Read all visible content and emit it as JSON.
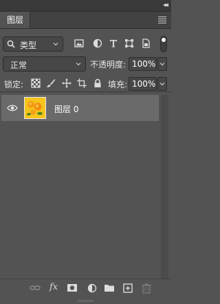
{
  "window": {
    "collapse_icon": "double-chevron-right-icon"
  },
  "tabs": [
    {
      "label": "图层",
      "active": true
    }
  ],
  "panel_menu_icon": "hamburger-menu-icon",
  "filter": {
    "selected": "类型",
    "icons": [
      "pixel-filter-icon",
      "adjustment-filter-icon",
      "type-filter-icon",
      "shape-filter-icon",
      "smart-object-filter-icon"
    ],
    "toggle_on": true
  },
  "blend": {
    "mode": "正常",
    "opacity_label": "不透明度:",
    "opacity_value": "100%"
  },
  "lock": {
    "label": "锁定:",
    "icons": [
      "lock-transparent-pixels-icon",
      "lock-image-pixels-icon",
      "lock-position-icon",
      "lock-artboard-icon",
      "lock-all-icon"
    ],
    "fill_label": "填充:",
    "fill_value": "100%"
  },
  "layers": [
    {
      "name": "图层 0",
      "visible": true,
      "selected": true,
      "thumbnail": "flowers-thumbnail"
    }
  ],
  "bottom_bar": {
    "fx_label": "fx",
    "icons": [
      "link-layers-icon",
      "fx-icon",
      "add-mask-icon",
      "adjustment-layer-icon",
      "new-group-icon",
      "new-layer-icon",
      "delete-layer-icon"
    ]
  },
  "colors": {
    "panel_bg": "#535353",
    "tab_bar_bg": "#424242",
    "selected_row_bg": "#6a6a6a",
    "input_bg": "#474747"
  }
}
